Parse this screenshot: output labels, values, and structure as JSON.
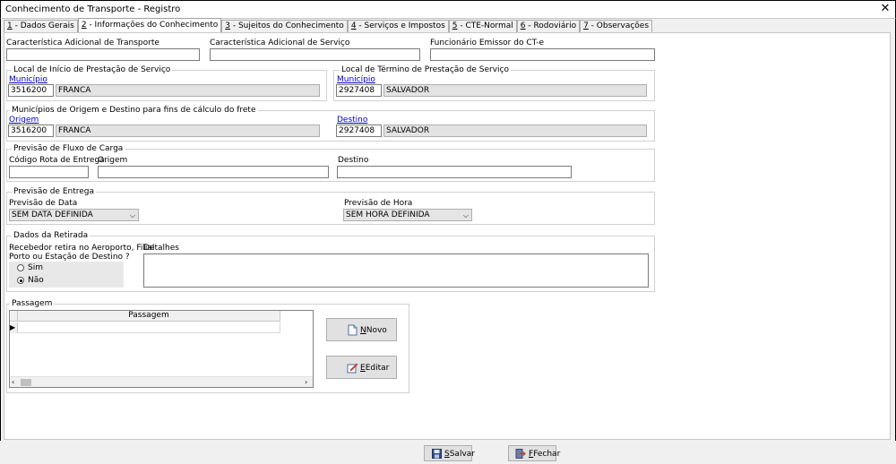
{
  "window": {
    "title": "Conhecimento de Transporte - Registro",
    "close": "✕"
  },
  "tabs": [
    {
      "key": "1",
      "label": " - Dados Gerais"
    },
    {
      "key": "2",
      "label": " - Informações do Conhecimento"
    },
    {
      "key": "3",
      "label": " - Sujeitos do Conhecimento"
    },
    {
      "key": "4",
      "label": " - Serviços e Impostos"
    },
    {
      "key": "5",
      "label": " - CTE-Normal"
    },
    {
      "key": "6",
      "label": " - Rodoviário"
    },
    {
      "key": "7",
      "label": " - Observações"
    }
  ],
  "top_fields": {
    "caract_transporte": {
      "label": "Característica Adicional de Transporte",
      "value": ""
    },
    "caract_servico": {
      "label": "Característica Adicional de Serviço",
      "value": ""
    },
    "funcionario": {
      "label": "Funcionário Emissor do CT-e",
      "value": ""
    }
  },
  "inicio": {
    "legend": "Local de Início de Prestação de Serviço",
    "link": "Município",
    "code": "3516200",
    "name": "FRANCA"
  },
  "termino": {
    "legend": "Local de Término de Prestação de Serviço",
    "link": "Município",
    "code": "2927408",
    "name": "SALVADOR"
  },
  "municipios": {
    "legend": "Municípios de Origem e Destino para fins de cálculo do frete",
    "origem_link": "Origem",
    "origem_code": "3516200",
    "origem_name": "FRANCA",
    "destino_link": "Destino",
    "destino_code": "2927408",
    "destino_name": "SALVADOR"
  },
  "fluxo": {
    "legend": "Previsão de Fluxo de Carga",
    "codigo_label": "Código Rota de Entrega",
    "origem_label": "Origem",
    "destino_label": "Destino",
    "codigo": "",
    "origem": "",
    "destino": ""
  },
  "entrega": {
    "legend": "Previsão de Entrega",
    "data_label": "Previsão de Data",
    "data_value": "SEM DATA DEFINIDA",
    "hora_label": "Previsão de Hora",
    "hora_value": "SEM HORA DEFINIDA"
  },
  "retirada": {
    "legend": "Dados da Retirada",
    "question_line1": "Recebedor retira no Aeroporto, Filial",
    "question_line2": "Porto ou Estação de Destino ?",
    "sim": "Sim",
    "nao": "Não",
    "selected": "Não",
    "detalhes_label": "Detalhes",
    "detalhes": ""
  },
  "passagem": {
    "legend": "Passagem",
    "column": "Passagem",
    "novo": "Novo",
    "novo_key": "N",
    "editar": "Editar",
    "editar_key": "E"
  },
  "footer": {
    "salvar": "Salvar",
    "salvar_key": "S",
    "fechar": "Fechar",
    "fechar_key": "F"
  }
}
